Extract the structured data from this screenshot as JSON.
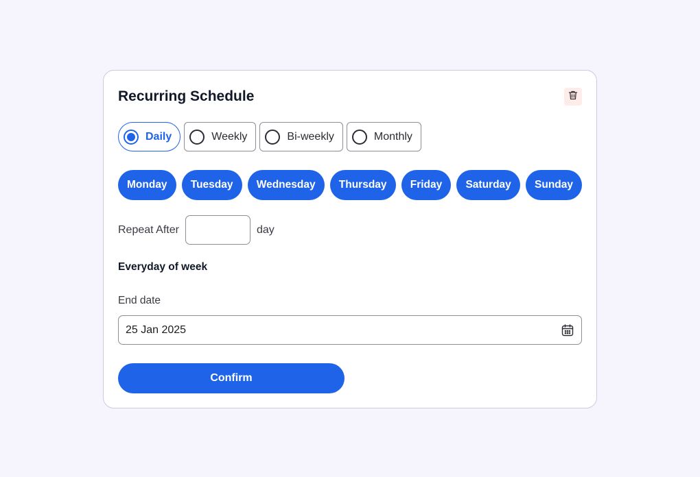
{
  "header": {
    "title": "Recurring Schedule",
    "delete_icon": "trash-icon"
  },
  "frequency": {
    "selected": "Daily",
    "options": [
      {
        "label": "Daily",
        "selected": true
      },
      {
        "label": "Weekly",
        "selected": false
      },
      {
        "label": "Bi-weekly",
        "selected": false
      },
      {
        "label": "Monthly",
        "selected": false
      }
    ]
  },
  "days": [
    "Monday",
    "Tuesday",
    "Wednesday",
    "Thursday",
    "Friday",
    "Saturday",
    "Sunday"
  ],
  "repeat": {
    "label": "Repeat After",
    "value": "",
    "unit": "day"
  },
  "summary": {
    "heading": "Everyday of week"
  },
  "end_date": {
    "label": "End date",
    "value": "25 Jan 2025",
    "icon": "calendar-icon"
  },
  "actions": {
    "confirm_label": "Confirm"
  },
  "colors": {
    "accent": "#1f64e8",
    "background": "#f6f5fd",
    "delete_bg": "#fdecea"
  }
}
